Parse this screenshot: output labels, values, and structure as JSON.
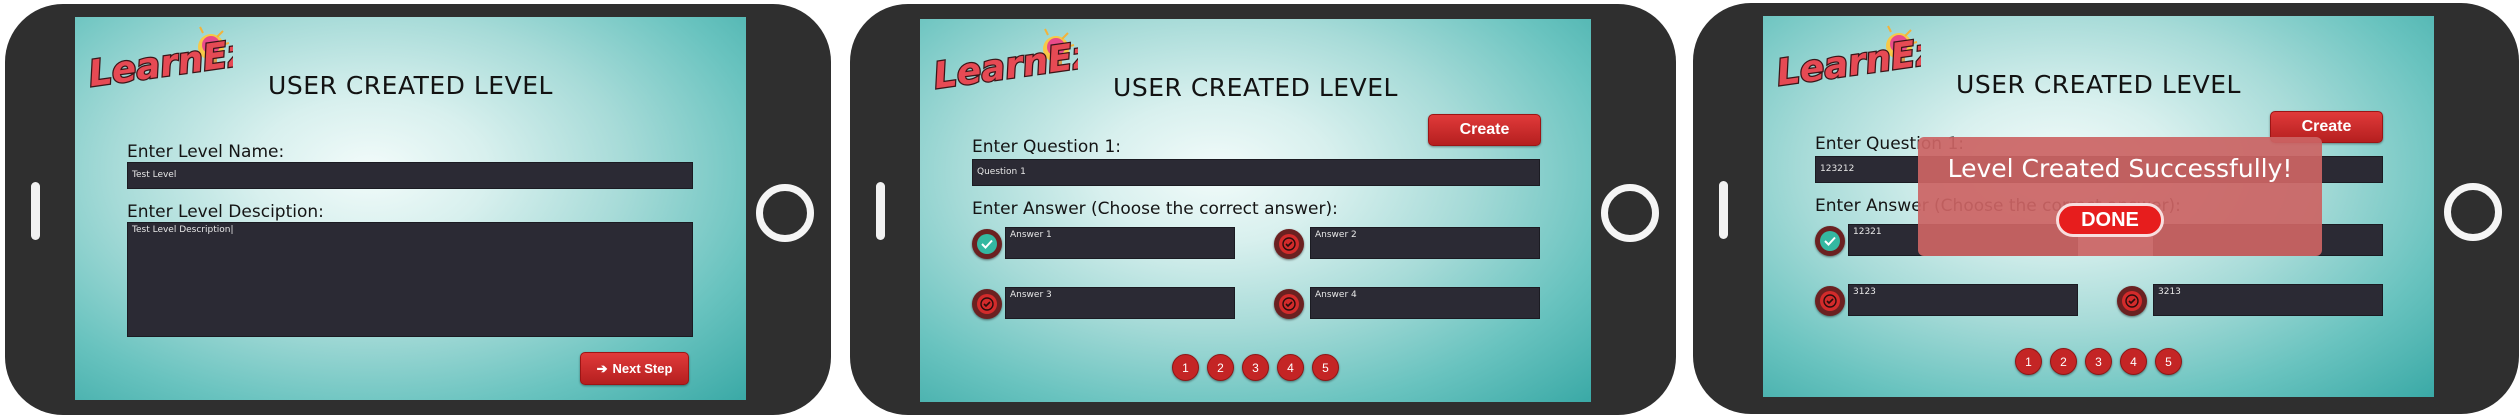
{
  "app": {
    "logo_text": "LearnEz"
  },
  "screens": [
    {
      "title": "USER CREATED LEVEL",
      "name_label": "Enter Level Name:",
      "name_value": "Test Level",
      "desc_label": "Enter Level Desciption:",
      "desc_value": "Test Level Description",
      "next_button": "Next Step"
    },
    {
      "title": "USER CREATED LEVEL",
      "create_button": "Create",
      "question_label": "Enter Question 1:",
      "question_value": "Question 1",
      "answer_label": "Enter Answer (Choose the correct answer):",
      "answers": [
        "Answer 1",
        "Answer 2",
        "Answer 3",
        "Answer 4"
      ],
      "pages": [
        "1",
        "2",
        "3",
        "4",
        "5"
      ]
    },
    {
      "title": "USER CREATED LEVEL",
      "create_button": "Create",
      "question_label": "Enter Question 1:",
      "question_value": "123212",
      "answer_label": "Enter Answer (Choose the correct answer):",
      "answers": [
        "12321",
        "",
        "3123",
        "3213"
      ],
      "pages": [
        "1",
        "2",
        "3",
        "4",
        "5"
      ],
      "modal": {
        "message": "Level Created Successfully!",
        "done_button": "DONE"
      }
    }
  ],
  "colors": {
    "accent": "#c42525",
    "field_bg": "#2b2a34",
    "correct": "#34b8a1"
  }
}
